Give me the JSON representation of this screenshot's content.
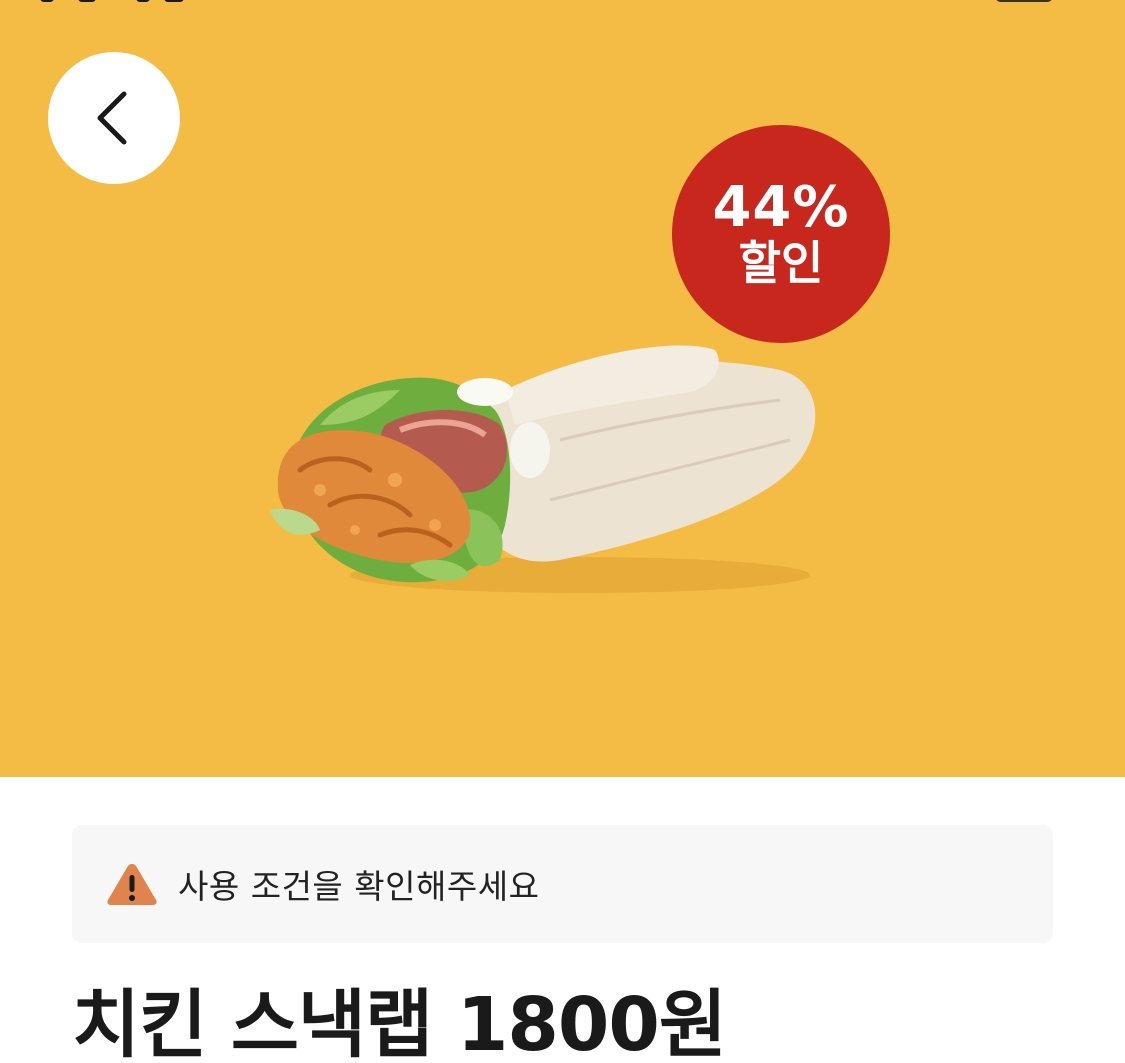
{
  "colors": {
    "hero_background": "#F4BC45",
    "badge_red": "#C8271E",
    "warning_orange": "#E0834D",
    "notice_background": "#F7F7F7",
    "text_dark": "#1a1a1a"
  },
  "header": {
    "back_icon": "chevron-left-icon"
  },
  "badge": {
    "percent": "44%",
    "label": "할인"
  },
  "product": {
    "image_icon": "wrap-food-image",
    "title": "치킨 스낵랩 1800원"
  },
  "notice": {
    "icon": "warning-icon",
    "text": "사용 조건을 확인해주세요"
  }
}
